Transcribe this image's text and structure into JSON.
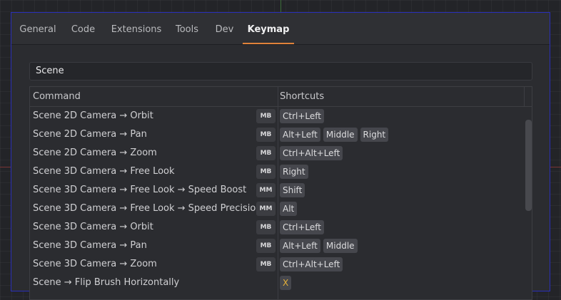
{
  "tabs": [
    "General",
    "Code",
    "Extensions",
    "Tools",
    "Dev",
    "Keymap"
  ],
  "active_tab": "Keymap",
  "search": {
    "value": "Scene",
    "placeholder": ""
  },
  "table": {
    "headers": {
      "command": "Command",
      "shortcuts": "Shortcuts"
    },
    "rows": [
      {
        "command": "Scene 2D Camera → Orbit",
        "badge": "MB",
        "keys": [
          "Ctrl+Left"
        ]
      },
      {
        "command": "Scene 2D Camera → Pan",
        "badge": "MB",
        "keys": [
          "Alt+Left",
          "Middle",
          "Right"
        ]
      },
      {
        "command": "Scene 2D Camera → Zoom",
        "badge": "MB",
        "keys": [
          "Ctrl+Alt+Left"
        ]
      },
      {
        "command": "Scene 3D Camera → Free Look",
        "badge": "MB",
        "keys": [
          "Right"
        ]
      },
      {
        "command": "Scene 3D Camera → Free Look → Speed Boost",
        "badge": "MM",
        "keys": [
          "Shift"
        ]
      },
      {
        "command": "Scene 3D Camera → Free Look → Speed Precision",
        "badge": "MM",
        "keys": [
          "Alt"
        ]
      },
      {
        "command": "Scene 3D Camera → Orbit",
        "badge": "MB",
        "keys": [
          "Ctrl+Left"
        ]
      },
      {
        "command": "Scene 3D Camera → Pan",
        "badge": "MB",
        "keys": [
          "Alt+Left",
          "Middle"
        ]
      },
      {
        "command": "Scene 3D Camera → Zoom",
        "badge": "MB",
        "keys": [
          "Ctrl+Alt+Left"
        ]
      },
      {
        "command": "Scene → Flip Brush Horizontally",
        "badge": "",
        "keys": [
          "X"
        ]
      }
    ]
  },
  "colors": {
    "accent": "#e0823a",
    "window_border": "#2a2fb8",
    "highlight_key": "#e6b13a"
  }
}
